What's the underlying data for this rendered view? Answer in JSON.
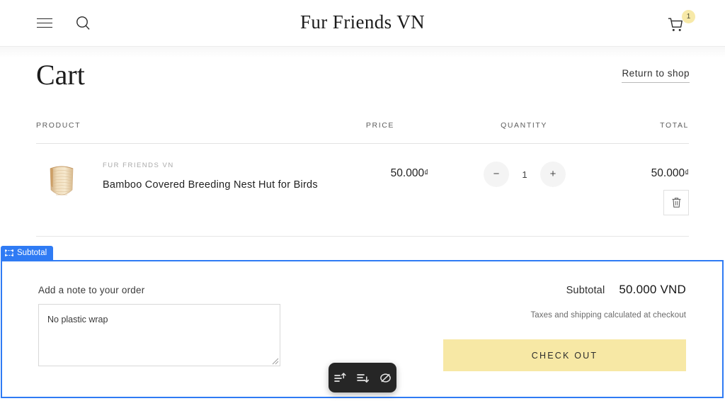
{
  "header": {
    "title": "Fur Friends VN",
    "menu_icon": "hamburger-menu-icon",
    "search_icon": "search-icon",
    "cart_icon": "shopping-cart-icon",
    "cart_count": "1"
  },
  "page": {
    "title": "Cart",
    "return_link": "Return to shop"
  },
  "table": {
    "headers": {
      "product": "PRODUCT",
      "price": "PRICE",
      "quantity": "QUANTITY",
      "total": "TOTAL"
    },
    "rows": [
      {
        "vendor": "FUR FRIENDS VN",
        "name": "Bamboo Covered Breeding Nest Hut for Birds",
        "image_alt": "bamboo-woven-nest-basket",
        "price": "50.000",
        "currency_symbol": "₫",
        "qty_decrease": "−",
        "quantity": "1",
        "qty_increase": "+",
        "total": "50.000",
        "remove_icon": "trash-icon"
      }
    ]
  },
  "highlight": {
    "tag_label": "Subtotal",
    "tag_icon": "element-select-icon",
    "border_color": "#2f7bf4"
  },
  "footer": {
    "note_label": "Add a note to your order",
    "note_value": "No plastic wrap",
    "note_placeholder": "",
    "subtotal_label": "Subtotal",
    "subtotal_value": "50.000 VND",
    "tax_note": "Taxes and shipping calculated at checkout",
    "checkout_label": "Check out",
    "checkout_color": "#f7e8a5"
  },
  "toolbar": {
    "buttons": [
      {
        "name": "insert-above-icon",
        "label": ""
      },
      {
        "name": "insert-below-icon",
        "label": ""
      },
      {
        "name": "disable-hide-icon",
        "label": ""
      }
    ]
  }
}
